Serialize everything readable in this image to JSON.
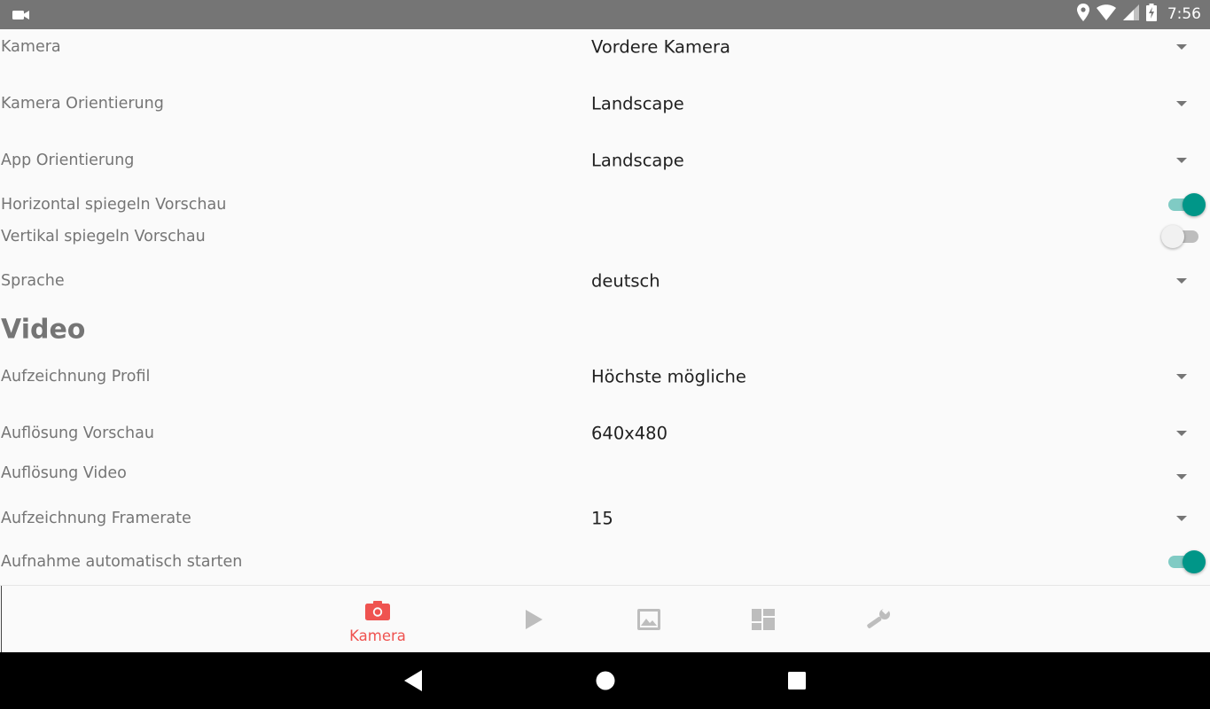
{
  "status_bar": {
    "time": "7:56",
    "icons": [
      "video-camera-icon",
      "location-icon",
      "wifi-icon",
      "signal-icon",
      "battery-icon"
    ]
  },
  "settings": {
    "camera": {
      "label": "Kamera",
      "value": "Vordere Kamera"
    },
    "camera_orientation": {
      "label": "Kamera Orientierung",
      "value": "Landscape"
    },
    "app_orientation": {
      "label": "App Orientierung",
      "value": "Landscape"
    },
    "mirror_horizontal": {
      "label": "Horizontal spiegeln Vorschau",
      "checked": true
    },
    "mirror_vertical": {
      "label": "Vertikal spiegeln Vorschau",
      "checked": false
    },
    "language": {
      "label": "Sprache",
      "value": "deutsch"
    }
  },
  "video": {
    "section_title": "Video",
    "record_profile": {
      "label": "Aufzeichnung Profil",
      "value": "Höchste mögliche"
    },
    "preview_resolution": {
      "label": "Auflösung Vorschau",
      "value": "640x480"
    },
    "video_resolution": {
      "label": "Auflösung Video",
      "value": ""
    },
    "framerate": {
      "label": "Aufzeichnung Framerate",
      "value": "15"
    },
    "autostart": {
      "label": "Aufnahme automatisch starten",
      "checked": true
    }
  },
  "tabs": [
    {
      "label": "Kamera",
      "icon": "camera-icon",
      "active": true
    },
    {
      "label": "",
      "icon": "play-icon",
      "active": false
    },
    {
      "label": "",
      "icon": "image-icon",
      "active": false
    },
    {
      "label": "",
      "icon": "dashboard-icon",
      "active": false
    },
    {
      "label": "",
      "icon": "wrench-icon",
      "active": false
    }
  ],
  "colors": {
    "accent": "#ef5350",
    "toggle_on": "#009688",
    "inactive_icon": "#bdbdbd"
  },
  "nav_bar": {
    "buttons": [
      "back-icon",
      "home-icon",
      "recents-icon"
    ]
  }
}
